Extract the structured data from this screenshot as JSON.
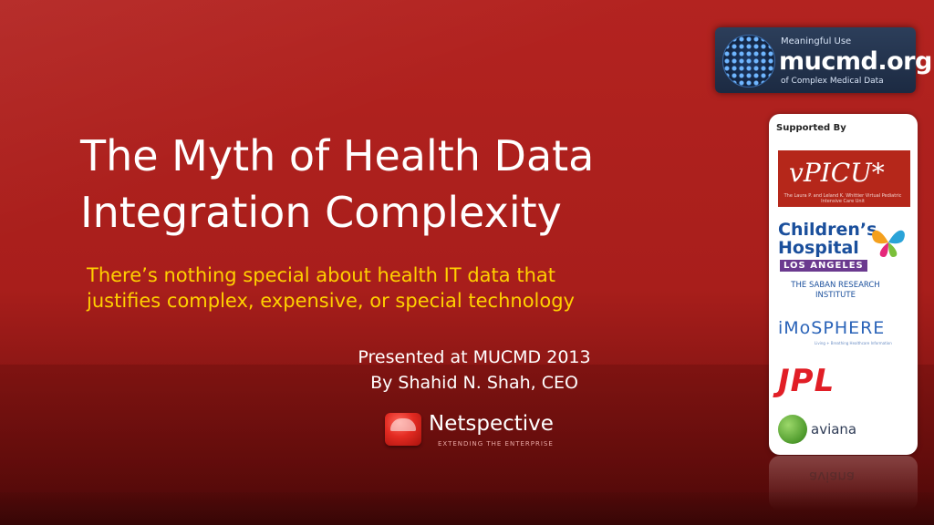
{
  "slide": {
    "title_lines": [
      "The Myth of Health Data",
      "Integration Complexity"
    ],
    "subtitle_lines": [
      "There’s nothing special about health IT data that",
      "justifies complex, expensive, or special technology"
    ],
    "presented": [
      "Presented at MUCMD 2013",
      "By Shahid N. Shah, CEO"
    ]
  },
  "netspective": {
    "name": "Netspective",
    "tagline": "EXTENDING THE ENTERPRISE"
  },
  "mucmd_badge": {
    "line1": "Meaningful Use",
    "line2": "mucmd.org",
    "line3": "of Complex Medical Data"
  },
  "supporters": {
    "header": "Supported By",
    "vpicu": {
      "name": "vPICU*",
      "sub": "The Laura P. and Leland K. Whittier Virtual Pediatric Intensive Care Unit"
    },
    "chla": {
      "name_line1": "Children’s",
      "name_line2": "Hospital",
      "city": "LOS ANGELES",
      "institute": "THE SABAN RESEARCH INSTITUTE"
    },
    "imosphere": {
      "name": "iMoSPHERE",
      "tagline": "Living + Breathing Healthcare Information"
    },
    "jpl": {
      "name": "JPL"
    },
    "aviana": {
      "name": "aviana"
    }
  },
  "colors": {
    "background": "#b32320",
    "subtitle": "#ffd000",
    "title": "#ffffff"
  }
}
